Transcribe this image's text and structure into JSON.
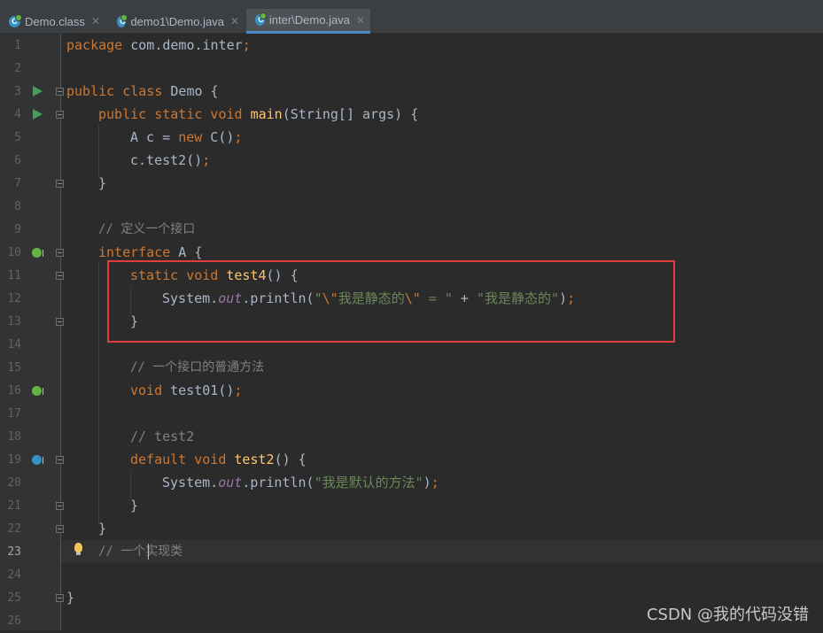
{
  "tabs": [
    {
      "label": "Demo.class",
      "active": false,
      "icon": "class-file-icon"
    },
    {
      "label": "demo1\\Demo.java",
      "active": false,
      "icon": "java-class-icon"
    },
    {
      "label": "inter\\Demo.java",
      "active": true,
      "icon": "java-class-icon"
    }
  ],
  "line_numbers": [
    "1",
    "2",
    "3",
    "4",
    "5",
    "6",
    "7",
    "8",
    "9",
    "10",
    "11",
    "12",
    "13",
    "14",
    "15",
    "16",
    "17",
    "18",
    "19",
    "20",
    "21",
    "22",
    "23",
    "24",
    "25",
    "26"
  ],
  "current_line": "23",
  "code": {
    "l1": {
      "a": "package",
      "b": " com.demo.inter",
      "c": ";"
    },
    "l3": {
      "a": "public class",
      "b": " Demo {"
    },
    "l4": {
      "a": "public static void",
      "b": "main",
      "c": "(String[] args) {"
    },
    "l5": {
      "a": "A c = ",
      "b": "new",
      "c": " C()",
      "d": ";"
    },
    "l6": {
      "a": "c.test2()",
      "b": ";"
    },
    "l7": {
      "a": "}"
    },
    "l9": {
      "a": "// 定义一个接口"
    },
    "l10": {
      "a": "interface",
      "b": " A {"
    },
    "l11": {
      "a": "static void",
      "b": "test4",
      "c": "() {"
    },
    "l12": {
      "a": "System.",
      "b": "out",
      "c": ".println(",
      "d": "\"",
      "e": "\\\"",
      "f": "我是静态的",
      "g": "\\\"",
      "h": " = \"",
      "i": " + ",
      "j": "\"我是静态的\"",
      "k": ")",
      "l": ";"
    },
    "l13": {
      "a": "}"
    },
    "l15": {
      "a": "// 一个接口的普通方法"
    },
    "l16": {
      "a": "void",
      "b": "test01",
      "c": "()",
      "d": ";"
    },
    "l18": {
      "a": "// test2"
    },
    "l19": {
      "a": "default void",
      "b": "test2",
      "c": "() {"
    },
    "l20": {
      "a": "System.",
      "b": "out",
      "c": ".println(",
      "d": "\"我是默认的方法\"",
      "e": ")",
      "f": ";"
    },
    "l21": {
      "a": "}"
    },
    "l22": {
      "a": "}"
    },
    "l23": {
      "a": "// 一个",
      "b": "实现类"
    },
    "l25": {
      "a": "}"
    }
  },
  "colors": {
    "keyword": "#cc7832",
    "method": "#ffc66d",
    "string": "#6a8759",
    "comment": "#808080",
    "static_field": "#9876aa",
    "highlight_box": "#e33c3c"
  },
  "watermark": "CSDN @我的代码没错"
}
